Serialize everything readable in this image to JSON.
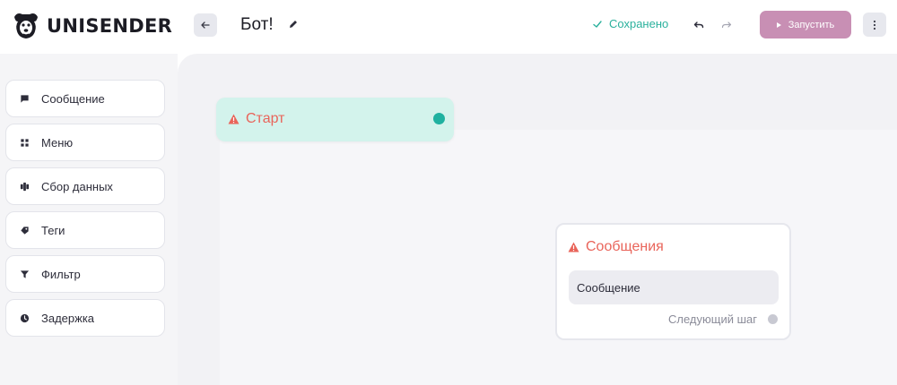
{
  "header": {
    "logo_text": "UNISENDER",
    "bot_title": "Бот!",
    "saved_label": "Сохранено",
    "run_label": "Запустить"
  },
  "sidebar": {
    "items": [
      {
        "label": "Сообщение",
        "icon": "message-icon"
      },
      {
        "label": "Меню",
        "icon": "grid-icon"
      },
      {
        "label": "Сбор данных",
        "icon": "data-collect-icon"
      },
      {
        "label": "Теги",
        "icon": "tag-icon"
      },
      {
        "label": "Фильтр",
        "icon": "filter-icon"
      },
      {
        "label": "Задержка",
        "icon": "clock-icon"
      }
    ]
  },
  "canvas": {
    "start_node": {
      "label": "Старт"
    },
    "message_node": {
      "label": "Сообщения",
      "field_text": "Сообщение",
      "next_step": "Следующий шаг"
    }
  },
  "colors": {
    "accent_teal": "#2bb19d",
    "run_button": "#c88fb4",
    "warning": "#e9645a",
    "start_node_bg": "#d3f3ec"
  }
}
